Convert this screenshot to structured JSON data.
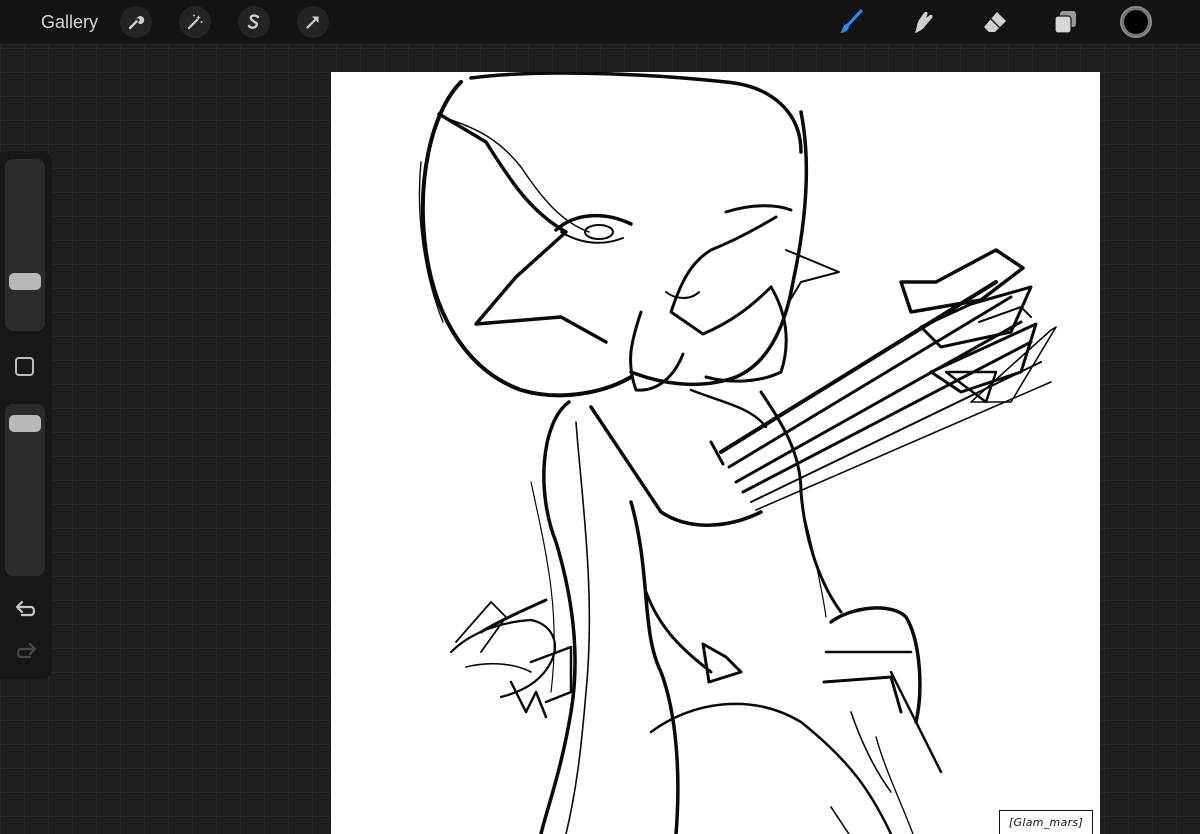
{
  "topbar": {
    "gallery_label": "Gallery",
    "left_tools": [
      "wrench-icon",
      "magic-wand-icon",
      "selection-s-icon",
      "transform-arrow-icon"
    ],
    "right_tools": [
      "brush-icon",
      "smudge-icon",
      "eraser-icon",
      "layers-icon"
    ],
    "active_tool": "brush",
    "active_color": "#000000",
    "accent_color": "#1e90ff"
  },
  "sidebar": {
    "brush_size_level": 0.25,
    "opacity_level": 0.95
  },
  "canvas": {
    "signature": "[Glam_mars]"
  }
}
